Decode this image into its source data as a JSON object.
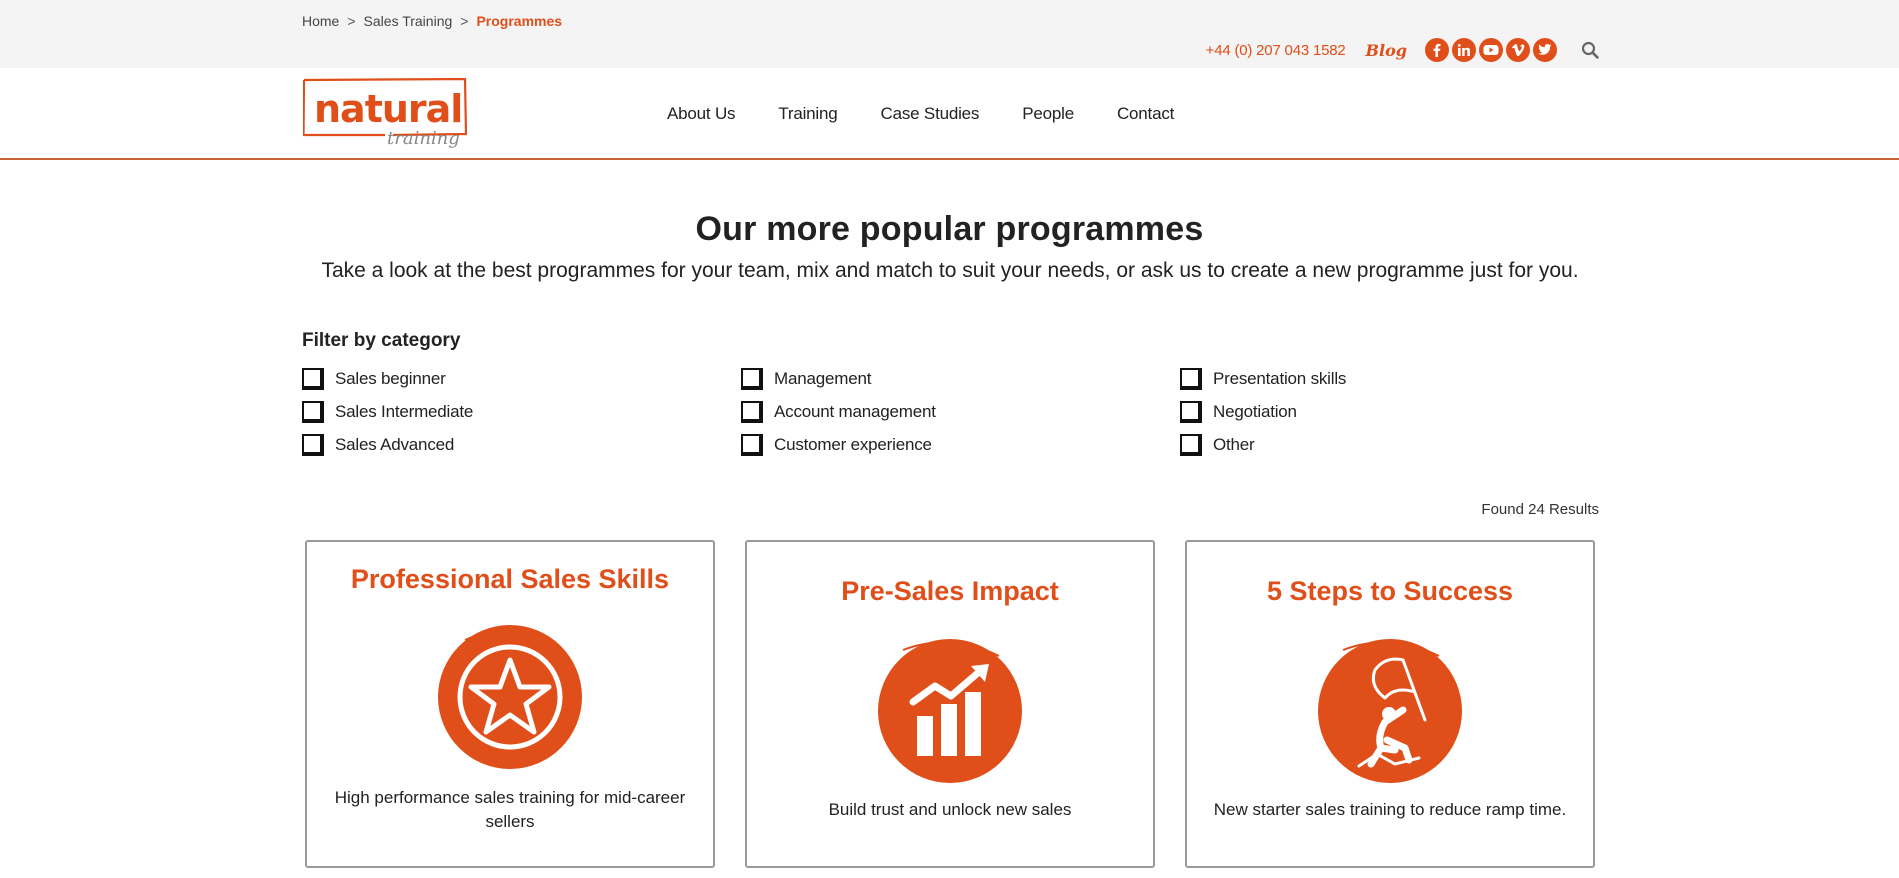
{
  "breadcrumb": {
    "items": [
      "Home",
      "Sales Training"
    ],
    "separator": ">",
    "current": "Programmes"
  },
  "contact": {
    "phone": "+44 (0) 207 043 1582",
    "blog": "Blog"
  },
  "social_icons": [
    "facebook-icon",
    "linkedin-icon",
    "youtube-icon",
    "vimeo-icon",
    "twitter-icon"
  ],
  "logo": {
    "text": "natural",
    "subtext": "training"
  },
  "nav": {
    "items": [
      "About Us",
      "Training",
      "Case Studies",
      "People",
      "Contact"
    ]
  },
  "hero": {
    "title": "Our more popular programmes",
    "subtitle": "Take a look at the best programmes for your team, mix and match to suit your needs, or ask us to create a new programme just for you."
  },
  "filter": {
    "title": "Filter by category",
    "categories": [
      "Sales beginner",
      "Management",
      "Presentation skills",
      "Sales Intermediate",
      "Account management",
      "Negotiation",
      "Sales Advanced",
      "Customer experience",
      "Other"
    ]
  },
  "results_text": "Found 24 Results",
  "cards": [
    {
      "title": "Professional Sales Skills",
      "icon": "star-icon",
      "description": "High performance sales training for mid-career sellers"
    },
    {
      "title": "Pre-Sales Impact",
      "icon": "growth-chart-icon",
      "description": "Build trust and unlock new sales"
    },
    {
      "title": "5 Steps to Success",
      "icon": "flag-climber-icon",
      "description": "New starter sales training to reduce ramp time."
    }
  ],
  "colors": {
    "accent": "#e04e1a",
    "topbar_bg": "#f4f4f4",
    "text": "#222222",
    "card_border": "#9a9a9a"
  }
}
